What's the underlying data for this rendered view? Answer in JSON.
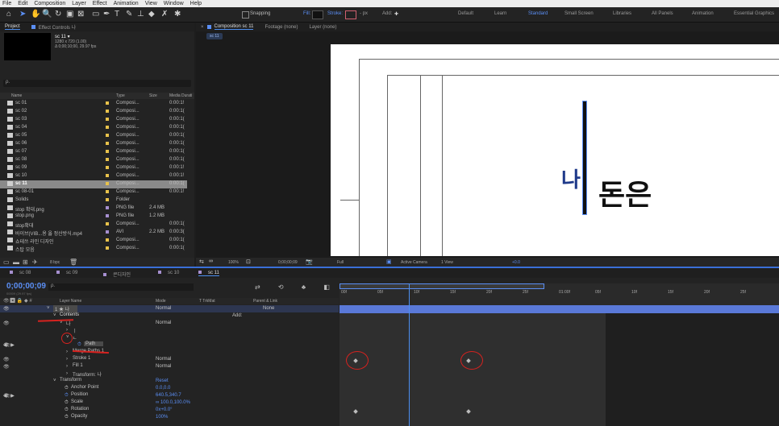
{
  "menu": [
    "File",
    "Edit",
    "Composition",
    "Layer",
    "Effect",
    "Animation",
    "View",
    "Window",
    "Help"
  ],
  "toolbar": {
    "snapping": "Snapping",
    "fill": "Fill:",
    "stroke": "Stroke:",
    "px": "- px",
    "add": "Add:",
    "workspaces": [
      "Default",
      "Learn",
      "Standard",
      "Small Screen",
      "Libraries",
      "All Panels",
      "Animation",
      "Essential Graphics"
    ],
    "active_workspace": "Standard"
  },
  "project": {
    "tab_project": "Project",
    "tab_effects": "Effect Controls 나",
    "comp_name": "sc 11 ▾",
    "comp_info1": "1280 x 720 (1.00)",
    "comp_info2": "Δ 0;00;10;00, 29.97 fps",
    "search_placeholder": "ρ.",
    "columns": [
      "Name",
      "Type",
      "Size",
      "Media Durati"
    ],
    "items": [
      {
        "name": "sc 01",
        "type": "Composi...",
        "size": "",
        "dur": "0:00:1!",
        "color": "#e8c24b",
        "sel": false
      },
      {
        "name": "sc 02",
        "type": "Composi...",
        "size": "",
        "dur": "0:00:1(",
        "color": "#e8c24b",
        "sel": false
      },
      {
        "name": "sc 03",
        "type": "Composi...",
        "size": "",
        "dur": "0:00:1(",
        "color": "#e8c24b",
        "sel": false
      },
      {
        "name": "sc 04",
        "type": "Composi...",
        "size": "",
        "dur": "0:00:1(",
        "color": "#e8c24b",
        "sel": false
      },
      {
        "name": "sc 05",
        "type": "Composi...",
        "size": "",
        "dur": "0:00:1(",
        "color": "#e8c24b",
        "sel": false
      },
      {
        "name": "sc 06",
        "type": "Composi...",
        "size": "",
        "dur": "0:00:1(",
        "color": "#e8c24b",
        "sel": false
      },
      {
        "name": "sc 07",
        "type": "Composi...",
        "size": "",
        "dur": "0:00:1(",
        "color": "#e8c24b",
        "sel": false
      },
      {
        "name": "sc 08",
        "type": "Composi...",
        "size": "",
        "dur": "0:00:1(",
        "color": "#e8c24b",
        "sel": false
      },
      {
        "name": "sc 09",
        "type": "Composi...",
        "size": "",
        "dur": "0:00:1!",
        "color": "#e8c24b",
        "sel": false
      },
      {
        "name": "sc 10",
        "type": "Composi...",
        "size": "",
        "dur": "0:00:1!",
        "color": "#e8c24b",
        "sel": false
      },
      {
        "name": "sc 11",
        "type": "Composi...",
        "size": "",
        "dur": "0:00:1(",
        "color": "#e8c24b",
        "sel": true
      },
      {
        "name": "sc 08-01",
        "type": "Composi...",
        "size": "",
        "dur": "0:00:1!",
        "color": "#e8c24b",
        "sel": false
      },
      {
        "name": "Solids",
        "type": "Folder",
        "size": "",
        "dur": "",
        "color": "#e8c24b",
        "sel": false
      },
      {
        "name": "stop 확대.png",
        "type": "PNG file",
        "size": "2.4 MB",
        "dur": "",
        "color": "#a68fd0",
        "sel": false
      },
      {
        "name": "stop.png",
        "type": "PNG file",
        "size": "1.2 MB",
        "dur": "",
        "color": "#a68fd0",
        "sel": false
      },
      {
        "name": "stop확대",
        "type": "Composi...",
        "size": "",
        "dur": "0:00:1(",
        "color": "#e8c24b",
        "sel": false
      },
      {
        "name": "바이브(VIB...용 옳 정산방식.mp4",
        "type": "AVI",
        "size": "2.2 MB",
        "dur": "0:00:3(",
        "color": "#a68fd0",
        "sel": false
      },
      {
        "name": "쇼테쓰 라인 디자인",
        "type": "Composi...",
        "size": "",
        "dur": "0:00:1(",
        "color": "#e8c24b",
        "sel": false
      },
      {
        "name": "스탑 모음",
        "type": "Composi...",
        "size": "",
        "dur": "0:00:1(",
        "color": "#e8c24b",
        "sel": false
      }
    ],
    "bpc": "8 bpc"
  },
  "viewer": {
    "tab": "Composition sc 11",
    "footage": "Footage (none)",
    "layer": "Layer (none)",
    "crumb": "sc 11",
    "text_ni": "나",
    "text_main": "돈은",
    "zoom": "100%",
    "timecode": "0;00;00;09",
    "quality": "Full",
    "camera": "Active Camera",
    "views": "1 View",
    "offset": "+0.0"
  },
  "timeline": {
    "tabs": [
      "sc 08",
      "sc 09",
      "콘디자인",
      "sc 10",
      "sc 11"
    ],
    "tab_colors": [
      "#a68fd0",
      "#a68fd0",
      "#a68fd0",
      "#a68fd0",
      "#a68fd0"
    ],
    "active_tab": "sc 11",
    "timecode": "0;00;00;09",
    "fps": "00009 (29.97 fps)",
    "search_placeholder": "ρ.",
    "headers": {
      "layer": "Layer Name",
      "mode": "Mode",
      "trkmat": "T  TrkMat",
      "parent": "Parent & Link"
    },
    "ruler": [
      "00f",
      "05f",
      "10f",
      "15f",
      "20f",
      "25f",
      "01:00f",
      "05f",
      "10f",
      "15f",
      "20f",
      "25f"
    ],
    "rows": [
      {
        "indent": 0,
        "twirl": "˅",
        "name": "1  ★ 나",
        "mode": "Normal",
        "parent": "None",
        "boxed": true
      },
      {
        "indent": 1,
        "twirl": "˅",
        "name": "Contents",
        "mode": "",
        "extra": "Add:",
        "boxed": false
      },
      {
        "indent": 2,
        "twirl": "˅",
        "name": "나",
        "mode": "Normal",
        "boxed": false
      },
      {
        "indent": 3,
        "twirl": "›",
        "name": "ㅣ",
        "mode": "",
        "boxed": false
      },
      {
        "indent": 3,
        "twirl": "˅",
        "name": "ㄴ",
        "mode": "",
        "boxed": false
      },
      {
        "indent": 4,
        "twirl": "",
        "name": "Path",
        "mode": "",
        "boxed": true,
        "stopwatch": true
      },
      {
        "indent": 3,
        "twirl": "›",
        "name": "Merge Paths 1",
        "mode": "",
        "boxed": false
      },
      {
        "indent": 3,
        "twirl": "›",
        "name": "Stroke 1",
        "mode": "Normal",
        "boxed": false
      },
      {
        "indent": 3,
        "twirl": "›",
        "name": "Fill 1",
        "mode": "Normal",
        "boxed": false
      },
      {
        "indent": 3,
        "twirl": "›",
        "name": "Transform: 나",
        "mode": "",
        "boxed": false
      },
      {
        "indent": 1,
        "twirl": "˅",
        "name": "Transform",
        "mode": "Reset",
        "boxed": false
      },
      {
        "indent": 2,
        "twirl": "",
        "name": "Anchor Point",
        "mode": "0.0,0.0",
        "boxed": false
      },
      {
        "indent": 2,
        "twirl": "",
        "name": "Position",
        "mode": "640.5,340.7",
        "boxed": false,
        "stopwatch": true
      },
      {
        "indent": 2,
        "twirl": "",
        "name": "Scale",
        "mode": "∞ 100.0,100.0%",
        "boxed": false
      },
      {
        "indent": 2,
        "twirl": "",
        "name": "Rotation",
        "mode": "0x+0.0°",
        "boxed": false
      },
      {
        "indent": 2,
        "twirl": "",
        "name": "Opacity",
        "mode": "100%",
        "boxed": false
      }
    ]
  },
  "colors": {
    "accent": "#4c8ff0",
    "annotation": "#d6221f",
    "comp_bg": "#ffffff",
    "value_blue": "#5b8ff5",
    "layer_bar": "#5a79d8"
  }
}
